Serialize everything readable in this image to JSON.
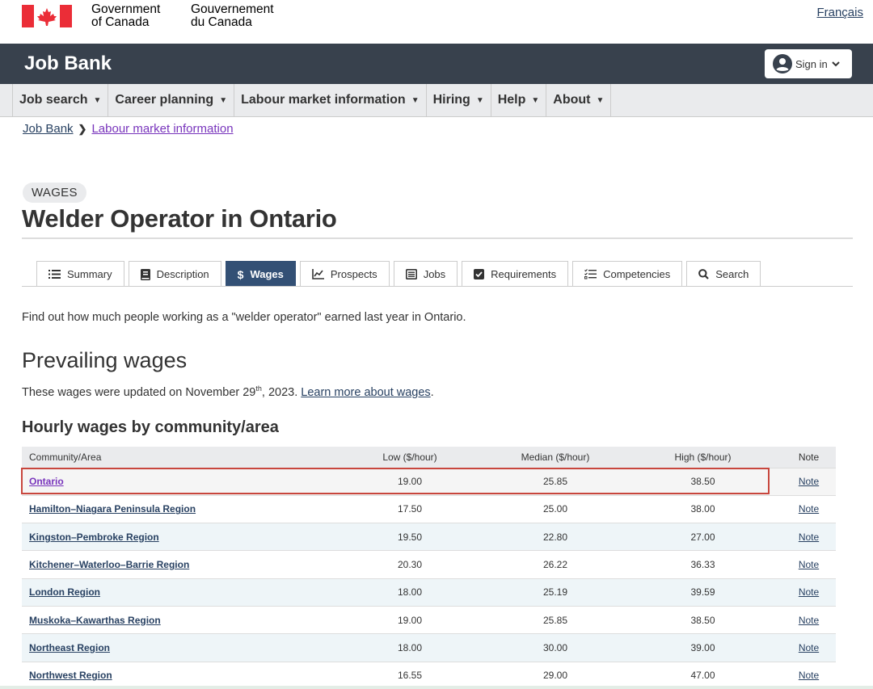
{
  "gov_header": {
    "signature_en": [
      "Government",
      "of Canada"
    ],
    "signature_fr": [
      "Gouvernement",
      "du Canada"
    ],
    "language_link": "Français",
    "flag_color": "#eb2d37"
  },
  "app_bar": {
    "title": "Job Bank",
    "signin_label": "Sign in",
    "background": "#38414d"
  },
  "menu": {
    "items": [
      {
        "label": "Job search"
      },
      {
        "label": "Career planning"
      },
      {
        "label": "Labour market information"
      },
      {
        "label": "Hiring"
      },
      {
        "label": "Help"
      },
      {
        "label": "About"
      }
    ]
  },
  "breadcrumb": {
    "items": [
      "Job Bank",
      "Labour market information"
    ]
  },
  "page": {
    "badge": "WAGES",
    "title": "Welder Operator in Ontario",
    "intro": "Find out how much people working as a \"welder operator\" earned last year in Ontario."
  },
  "tabs": [
    {
      "label": "Summary",
      "icon": "list-icon",
      "active": false
    },
    {
      "label": "Description",
      "icon": "book-icon",
      "active": false
    },
    {
      "label": "Wages",
      "icon": "dollar-icon",
      "active": true
    },
    {
      "label": "Prospects",
      "icon": "chart-line-icon",
      "active": false
    },
    {
      "label": "Jobs",
      "icon": "list-alt-icon",
      "active": false
    },
    {
      "label": "Requirements",
      "icon": "checkbox-icon",
      "active": false
    },
    {
      "label": "Competencies",
      "icon": "tasks-icon",
      "active": false
    },
    {
      "label": "Search",
      "icon": "search-icon",
      "active": false
    }
  ],
  "prevailing": {
    "heading": "Prevailing wages",
    "updated_prefix": "These wages were updated on November 29",
    "updated_sup": "th",
    "updated_suffix": ", 2023. ",
    "learn_more": "Learn more about wages",
    "period": "."
  },
  "hourly": {
    "heading": "Hourly wages by community/area",
    "columns": [
      "Community/Area",
      "Low ($/hour)",
      "Median ($/hour)",
      "High ($/hour)",
      "Note"
    ],
    "rows": [
      {
        "area": "Ontario",
        "low": "19.00",
        "median": "25.85",
        "high": "38.50",
        "note": "Note"
      },
      {
        "area": "Hamilton–Niagara Peninsula Region",
        "low": "17.50",
        "median": "25.00",
        "high": "38.00",
        "note": "Note"
      },
      {
        "area": "Kingston–Pembroke Region",
        "low": "19.50",
        "median": "22.80",
        "high": "27.00",
        "note": "Note"
      },
      {
        "area": "Kitchener–Waterloo–Barrie Region",
        "low": "20.30",
        "median": "26.22",
        "high": "36.33",
        "note": "Note"
      },
      {
        "area": "London Region",
        "low": "18.00",
        "median": "25.19",
        "high": "39.59",
        "note": "Note"
      },
      {
        "area": "Muskoka–Kawarthas Region",
        "low": "19.00",
        "median": "25.85",
        "high": "38.50",
        "note": "Note"
      },
      {
        "area": "Northeast Region",
        "low": "18.00",
        "median": "30.00",
        "high": "39.00",
        "note": "Note"
      },
      {
        "area": "Northwest Region",
        "low": "16.55",
        "median": "29.00",
        "high": "47.00",
        "note": "Note"
      }
    ]
  }
}
